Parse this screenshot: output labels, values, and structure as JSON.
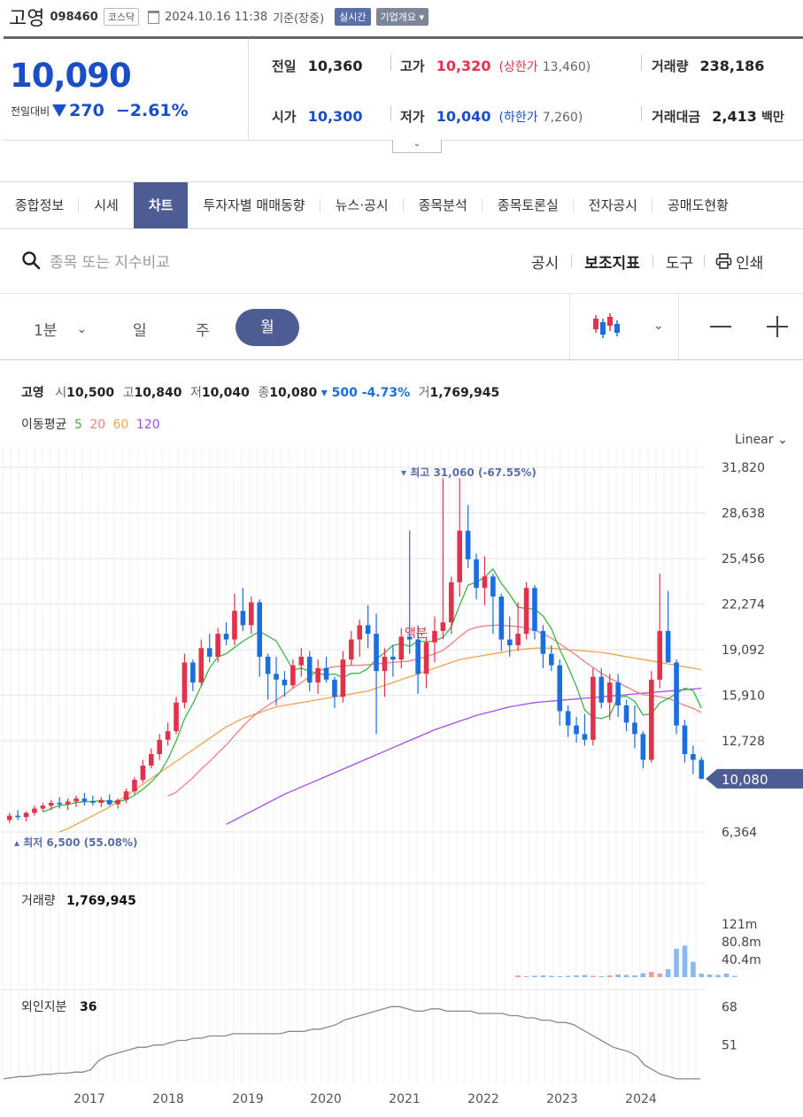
{
  "header": {
    "name": "고영",
    "code": "098460",
    "market": "코스닥",
    "datetime": "2024.10.16 11:38",
    "basis": "기준(장중)",
    "realtime": "실시간",
    "overview": "기업개요"
  },
  "quote": {
    "price": "10,090",
    "change_label": "전일대비",
    "change": "270",
    "change_pct": "−2.61%",
    "prev_label": "전일",
    "prev": "10,360",
    "high_label": "고가",
    "high": "10,320",
    "upper_label": "(상한가",
    "upper": "13,460)",
    "volume_label": "거래량",
    "volume": "238,186",
    "open_label": "시가",
    "open": "10,300",
    "low_label": "저가",
    "low": "10,040",
    "lower_label": "(하한가",
    "lower": "7,260)",
    "amount_label": "거래대금",
    "amount": "2,413",
    "amount_unit": "백만"
  },
  "tabs": [
    "종합정보",
    "시세",
    "차트",
    "투자자별 매매동향",
    "뉴스·공시",
    "종목분석",
    "종목토론실",
    "전자공시",
    "공매도현황"
  ],
  "toolbar": {
    "search_placeholder": "종목 또는 지수비교",
    "notice": "공시",
    "indicator": "보조지표",
    "tools": "도구",
    "print": "인쇄"
  },
  "periods": {
    "minute": "1분",
    "day": "일",
    "week": "주",
    "month": "월"
  },
  "ohlc": {
    "name": "고영",
    "o_label": "시",
    "o": "10,500",
    "h_label": "고",
    "h": "10,840",
    "l_label": "저",
    "l": "10,040",
    "c_label": "종",
    "c": "10,080",
    "chg": "▾ 500 -4.73%",
    "v_label": "거",
    "v": "1,769,945"
  },
  "ma_legend": {
    "label": "이동평균",
    "p5": "5",
    "p20": "20",
    "p60": "60",
    "p120": "120"
  },
  "colors": {
    "up": "#e0324b",
    "down": "#1a6fdc",
    "ma5": "#3bb54a",
    "ma20": "#f08080",
    "ma60": "#f5a34b",
    "ma120": "#a64ae8",
    "accent": "#4d5d94"
  },
  "chart_data": {
    "type": "candlestick",
    "scale": "Linear",
    "y_ticks": [
      "31,820",
      "28,638",
      "25,456",
      "22,274",
      "19,092",
      "15,910",
      "12,728",
      "6,364"
    ],
    "ylim": [
      6364,
      31820
    ],
    "x_ticks": [
      "2017",
      "2018",
      "2019",
      "2020",
      "2021",
      "2022",
      "2023",
      "2024"
    ],
    "current": "10,080",
    "max_label": "▾ 최고 31,060 (-67.55%)",
    "min_label": "▴ 최저 6,500 (55.08%)",
    "annotation": "액분",
    "candles": [
      [
        7200,
        7700,
        7000,
        7500
      ],
      [
        7500,
        7900,
        7200,
        7400
      ],
      [
        7400,
        7800,
        7100,
        7700
      ],
      [
        7700,
        8200,
        7500,
        8000
      ],
      [
        8000,
        8400,
        7800,
        8200
      ],
      [
        8200,
        8600,
        7900,
        8400
      ],
      [
        8400,
        8800,
        8000,
        8300
      ],
      [
        8300,
        8700,
        7900,
        8500
      ],
      [
        8500,
        8900,
        8100,
        8700
      ],
      [
        8700,
        9100,
        8200,
        8500
      ],
      [
        8500,
        8900,
        8200,
        8400
      ],
      [
        8400,
        8800,
        8100,
        8600
      ],
      [
        8600,
        9000,
        8200,
        8300
      ],
      [
        8300,
        8700,
        8000,
        8600
      ],
      [
        8600,
        9400,
        8400,
        9200
      ],
      [
        9200,
        10200,
        9000,
        10000
      ],
      [
        10000,
        11400,
        9800,
        11000
      ],
      [
        11000,
        12200,
        10800,
        11800
      ],
      [
        11800,
        13200,
        11400,
        12800
      ],
      [
        12800,
        14000,
        12400,
        13400
      ],
      [
        13400,
        15800,
        13200,
        15400
      ],
      [
        15400,
        18800,
        15000,
        18200
      ],
      [
        18200,
        18400,
        16200,
        16800
      ],
      [
        16800,
        19800,
        16600,
        19200
      ],
      [
        19200,
        20200,
        18200,
        18600
      ],
      [
        18600,
        20600,
        18200,
        20200
      ],
      [
        20200,
        21000,
        19400,
        19800
      ],
      [
        19800,
        23000,
        19400,
        21800
      ],
      [
        21800,
        23400,
        20400,
        20800
      ],
      [
        20800,
        22800,
        20200,
        22400
      ],
      [
        22400,
        22600,
        17200,
        18600
      ],
      [
        18600,
        18800,
        15600,
        17400
      ],
      [
        17400,
        18600,
        15200,
        17000
      ],
      [
        17000,
        17600,
        15800,
        16600
      ],
      [
        16600,
        18400,
        16400,
        18000
      ],
      [
        18000,
        19200,
        17200,
        18600
      ],
      [
        18600,
        19000,
        16200,
        16800
      ],
      [
        16800,
        18400,
        16000,
        17800
      ],
      [
        17800,
        18600,
        16800,
        17000
      ],
      [
        17000,
        17200,
        15000,
        15800
      ],
      [
        15800,
        19000,
        15400,
        18400
      ],
      [
        18400,
        20400,
        18000,
        19800
      ],
      [
        19800,
        21200,
        18600,
        20800
      ],
      [
        20800,
        22200,
        19200,
        20200
      ],
      [
        20200,
        21600,
        13200,
        17600
      ],
      [
        17600,
        19200,
        15800,
        18600
      ],
      [
        18600,
        19400,
        17200,
        18400
      ],
      [
        18400,
        20600,
        17800,
        20000
      ],
      [
        20000,
        27400,
        18800,
        19800
      ],
      [
        19800,
        20800,
        16000,
        17400
      ],
      [
        17400,
        20000,
        16400,
        19600
      ],
      [
        19600,
        21400,
        18200,
        20400
      ],
      [
        20400,
        31060,
        19800,
        21000
      ],
      [
        21000,
        24200,
        20200,
        23800
      ],
      [
        23800,
        31060,
        22800,
        27400
      ],
      [
        27400,
        29200,
        24800,
        25400
      ],
      [
        25400,
        25800,
        22600,
        23400
      ],
      [
        23400,
        25600,
        22200,
        24200
      ],
      [
        24200,
        24400,
        20200,
        22800
      ],
      [
        22800,
        23000,
        19000,
        19800
      ],
      [
        19800,
        21400,
        18600,
        19400
      ],
      [
        19400,
        22400,
        19000,
        20200
      ],
      [
        20200,
        23800,
        19800,
        23400
      ],
      [
        23400,
        23600,
        19800,
        20400
      ],
      [
        20400,
        20800,
        17800,
        18800
      ],
      [
        18800,
        19400,
        17600,
        18000
      ],
      [
        18000,
        18400,
        13800,
        14800
      ],
      [
        14800,
        15200,
        13000,
        13800
      ],
      [
        13800,
        14400,
        12600,
        13200
      ],
      [
        13200,
        14600,
        12400,
        12800
      ],
      [
        12800,
        17800,
        12400,
        17200
      ],
      [
        17200,
        17800,
        15000,
        15400
      ],
      [
        15400,
        17400,
        14200,
        16800
      ],
      [
        16800,
        17400,
        14400,
        15200
      ],
      [
        15200,
        15600,
        13400,
        14000
      ],
      [
        14000,
        15200,
        12200,
        13200
      ],
      [
        13200,
        13400,
        10800,
        11400
      ],
      [
        11400,
        17600,
        11200,
        17000
      ],
      [
        17000,
        24400,
        16400,
        20400
      ],
      [
        20400,
        23200,
        18600,
        18200
      ],
      [
        18200,
        18400,
        13200,
        13800
      ],
      [
        13800,
        14200,
        11200,
        11800
      ],
      [
        11800,
        12400,
        10400,
        11400
      ],
      [
        11400,
        11600,
        10040,
        10080
      ]
    ],
    "ma5": [
      null,
      null,
      null,
      null,
      7760,
      8000,
      8220,
      8280,
      8420,
      8480,
      8500,
      8540,
      8500,
      8480,
      8620,
      8940,
      9340,
      9860,
      10480,
      11440,
      12720,
      14280,
      15320,
      16560,
      17800,
      18600,
      18800,
      19260,
      19680,
      20040,
      20360,
      20040,
      19700,
      18700,
      17680,
      17800,
      17580,
      17440,
      17320,
      17400,
      17140,
      17440,
      17440,
      17780,
      18440,
      18880,
      19400,
      19500,
      19320,
      19700,
      19640,
      19700,
      19960,
      20680,
      22200,
      23600,
      23800,
      24160,
      24720,
      23720,
      22960,
      22060,
      21960,
      21920,
      21440,
      20560,
      19120,
      17900,
      16540,
      14880,
      14380,
      14280,
      14500,
      15760,
      15840,
      15480,
      14520,
      14620,
      15380,
      15660,
      16040,
      16400,
      16240,
      15000
    ],
    "ma20": [
      null,
      null,
      null,
      null,
      null,
      null,
      null,
      null,
      null,
      null,
      null,
      null,
      null,
      null,
      null,
      null,
      null,
      null,
      null,
      8870,
      9140,
      9660,
      10160,
      10760,
      11280,
      11880,
      12430,
      13110,
      13750,
      14320,
      14800,
      15200,
      15560,
      15960,
      16400,
      16800,
      17200,
      17600,
      17800,
      17900,
      17950,
      18000,
      18000,
      18050,
      18100,
      18150,
      18200,
      18250,
      18300,
      18450,
      18600,
      18800,
      19050,
      19500,
      20000,
      20450,
      20650,
      20750,
      20800,
      20800,
      20750,
      20700,
      20600,
      20450,
      20200,
      19900,
      19500,
      19100,
      18700,
      18250,
      17850,
      17450,
      17100,
      16800,
      16500,
      16200,
      15950,
      15900,
      15800,
      15700,
      15450,
      15200,
      15000,
      14700
    ],
    "ma60": [
      null,
      null,
      null,
      null,
      null,
      null,
      6364,
      6600,
      6900,
      7200,
      7500,
      7800,
      8100,
      8500,
      8900,
      9300,
      9700,
      10100,
      10500,
      10900,
      11300,
      11700,
      12100,
      12500,
      12900,
      13300,
      13700,
      14000,
      14300,
      14500,
      14700,
      14900,
      15100,
      15200,
      15300,
      15400,
      15500,
      15600,
      15700,
      15800,
      15900,
      16000,
      16100,
      16200,
      16400,
      16600,
      16800,
      17000,
      17200,
      17400,
      17600,
      17800,
      18000,
      18200,
      18400,
      18500,
      18600,
      18700,
      18800,
      18900,
      19000,
      19100,
      19150,
      19200,
      19200,
      19200,
      19150,
      19100,
      19050,
      19000,
      18950,
      18900,
      18800,
      18700,
      18600,
      18500,
      18400,
      18300,
      18200,
      18100,
      18000,
      17900,
      17800,
      17700
    ],
    "ma120": [
      null,
      null,
      null,
      null,
      null,
      null,
      null,
      null,
      null,
      null,
      null,
      null,
      null,
      null,
      null,
      null,
      null,
      null,
      null,
      null,
      null,
      null,
      null,
      null,
      null,
      null,
      6900,
      7200,
      7500,
      7800,
      8100,
      8400,
      8700,
      9000,
      9250,
      9500,
      9750,
      10000,
      10250,
      10500,
      10750,
      11000,
      11250,
      11500,
      11750,
      12000,
      12250,
      12500,
      12750,
      13000,
      13250,
      13500,
      13700,
      13900,
      14100,
      14300,
      14500,
      14650,
      14800,
      14950,
      15100,
      15200,
      15300,
      15400,
      15450,
      15500,
      15550,
      15600,
      15650,
      15700,
      15750,
      15800,
      15850,
      15900,
      15950,
      16000,
      16050,
      16100,
      16150,
      16200,
      16250,
      16300,
      16350,
      16400
    ],
    "volume": {
      "label": "거래량",
      "value": "1,769,945",
      "y_ticks": [
        "121m",
        "80.8m",
        "40.4m"
      ],
      "ylim": [
        0,
        121
      ]
    },
    "volume_bars": [
      0,
      0,
      0,
      0,
      0,
      0,
      0,
      0,
      0,
      0,
      0,
      0,
      0,
      0,
      0,
      0,
      0,
      0,
      0,
      0,
      0,
      0,
      0,
      0,
      0,
      0,
      0,
      0,
      0,
      0,
      0,
      0,
      0,
      0,
      0,
      0,
      0,
      0,
      0,
      0,
      0,
      0,
      0,
      0,
      0,
      0,
      0,
      0,
      0,
      0,
      0,
      0,
      0,
      0,
      0,
      0,
      0,
      0,
      0,
      0,
      0,
      4,
      2,
      3,
      4,
      3,
      2,
      3,
      4,
      5,
      3,
      2,
      4,
      6,
      5,
      4,
      9,
      12,
      8,
      18,
      65,
      72,
      35,
      8,
      6,
      5,
      8,
      3
    ],
    "foreign": {
      "label": "외인지분",
      "value": "36",
      "y_ticks": [
        "68",
        "51"
      ],
      "ylim": [
        34,
        74
      ]
    },
    "foreign_ratio": [
      36,
      36.5,
      37,
      37,
      37.5,
      38,
      38,
      38.5,
      38.5,
      39,
      39,
      40,
      44,
      46,
      47,
      48,
      49,
      50,
      50,
      51,
      51,
      52,
      53,
      53,
      54,
      54,
      55,
      55,
      55,
      56,
      56,
      56,
      56,
      56,
      56,
      56,
      57,
      57,
      57,
      58,
      58,
      59,
      60,
      62,
      63,
      64,
      65,
      66,
      67,
      68,
      68,
      67,
      66,
      66,
      67,
      67,
      66,
      66,
      66,
      66,
      65,
      65,
      65,
      65,
      64,
      64,
      63,
      63,
      62,
      62,
      61,
      61,
      60,
      58,
      56,
      54,
      52,
      50,
      49,
      48,
      46,
      42,
      40,
      38,
      37,
      36,
      36,
      36,
      36
    ]
  }
}
